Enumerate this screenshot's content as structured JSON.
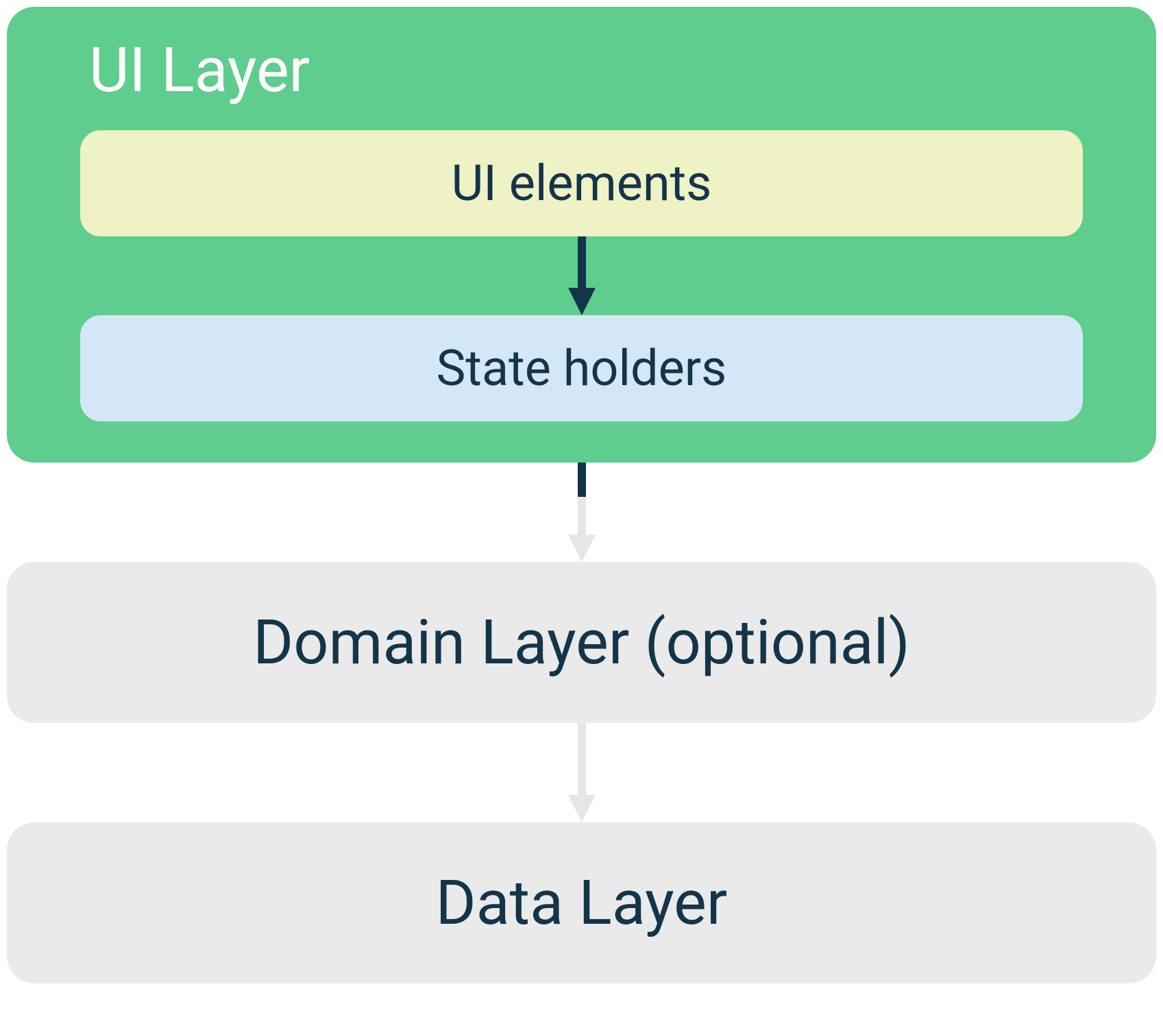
{
  "diagram": {
    "ui_layer": {
      "title": "UI Layer",
      "ui_elements_label": "UI elements",
      "state_holders_label": "State holders"
    },
    "domain_layer_label": "Domain Layer (optional)",
    "data_layer_label": "Data Layer"
  },
  "colors": {
    "ui_layer_bg": "#5ECD8D",
    "ui_elements_bg": "#EEF2C4",
    "state_holders_bg": "#D3E7F7",
    "layer_bg": "#EAEAEA",
    "text_dark": "#143449",
    "text_light": "#ffffff",
    "arrow_dark": "#143449",
    "arrow_light": "#E6E6E6"
  }
}
